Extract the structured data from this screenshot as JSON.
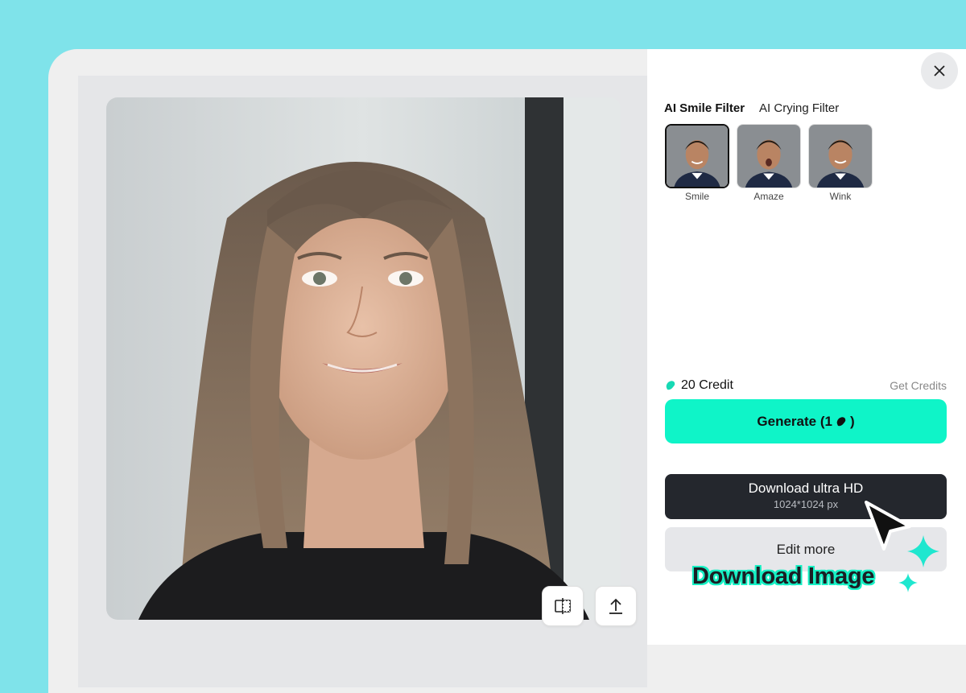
{
  "panel": {
    "tabs": [
      {
        "label": "AI Smile Filter",
        "active": true
      },
      {
        "label": "AI Crying Filter",
        "active": false
      }
    ],
    "filters": [
      {
        "label": "Smile",
        "selected": true
      },
      {
        "label": "Amaze",
        "selected": false
      },
      {
        "label": "Wink",
        "selected": false
      }
    ],
    "credits_label": "20 Credit",
    "get_credits_label": "Get Credits",
    "generate_label": "Generate (1",
    "generate_suffix": ")",
    "download_label": "Download ultra HD",
    "download_size": "1024*1024 px",
    "edit_label": "Edit more"
  },
  "callout": {
    "text": "Download Image"
  },
  "colors": {
    "background": "#7fe3ea",
    "accent": "#0ff4c8",
    "dark_button": "#24272d"
  },
  "icons": [
    "close-icon",
    "credit-bean-icon",
    "compare-icon",
    "share-icon",
    "cursor-arrow-icon",
    "sparkle-icon"
  ]
}
